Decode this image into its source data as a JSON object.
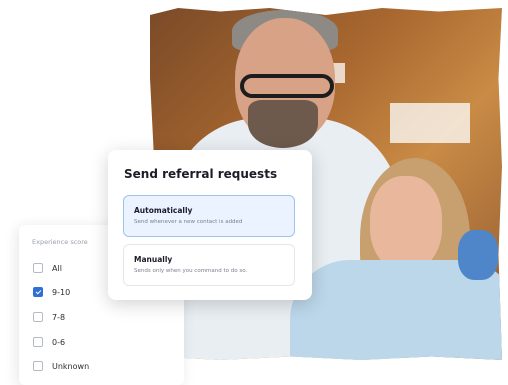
{
  "referral": {
    "title": "Send referral requests",
    "options": [
      {
        "title": "Automatically",
        "description": "Send whenever a new contact is added",
        "selected": true
      },
      {
        "title": "Manually",
        "description": "Sends only when you command to do so.",
        "selected": false
      }
    ]
  },
  "experience_score": {
    "label": "Experience score",
    "items": [
      {
        "label": "All",
        "checked": false
      },
      {
        "label": "9-10",
        "checked": true
      },
      {
        "label": "7-8",
        "checked": false
      },
      {
        "label": "0-6",
        "checked": false
      },
      {
        "label": "Unknown",
        "checked": false
      }
    ]
  },
  "colors": {
    "accent": "#2f6fd6",
    "selected_bg": "#eaf3ff",
    "selected_border": "#9cc2f0"
  }
}
